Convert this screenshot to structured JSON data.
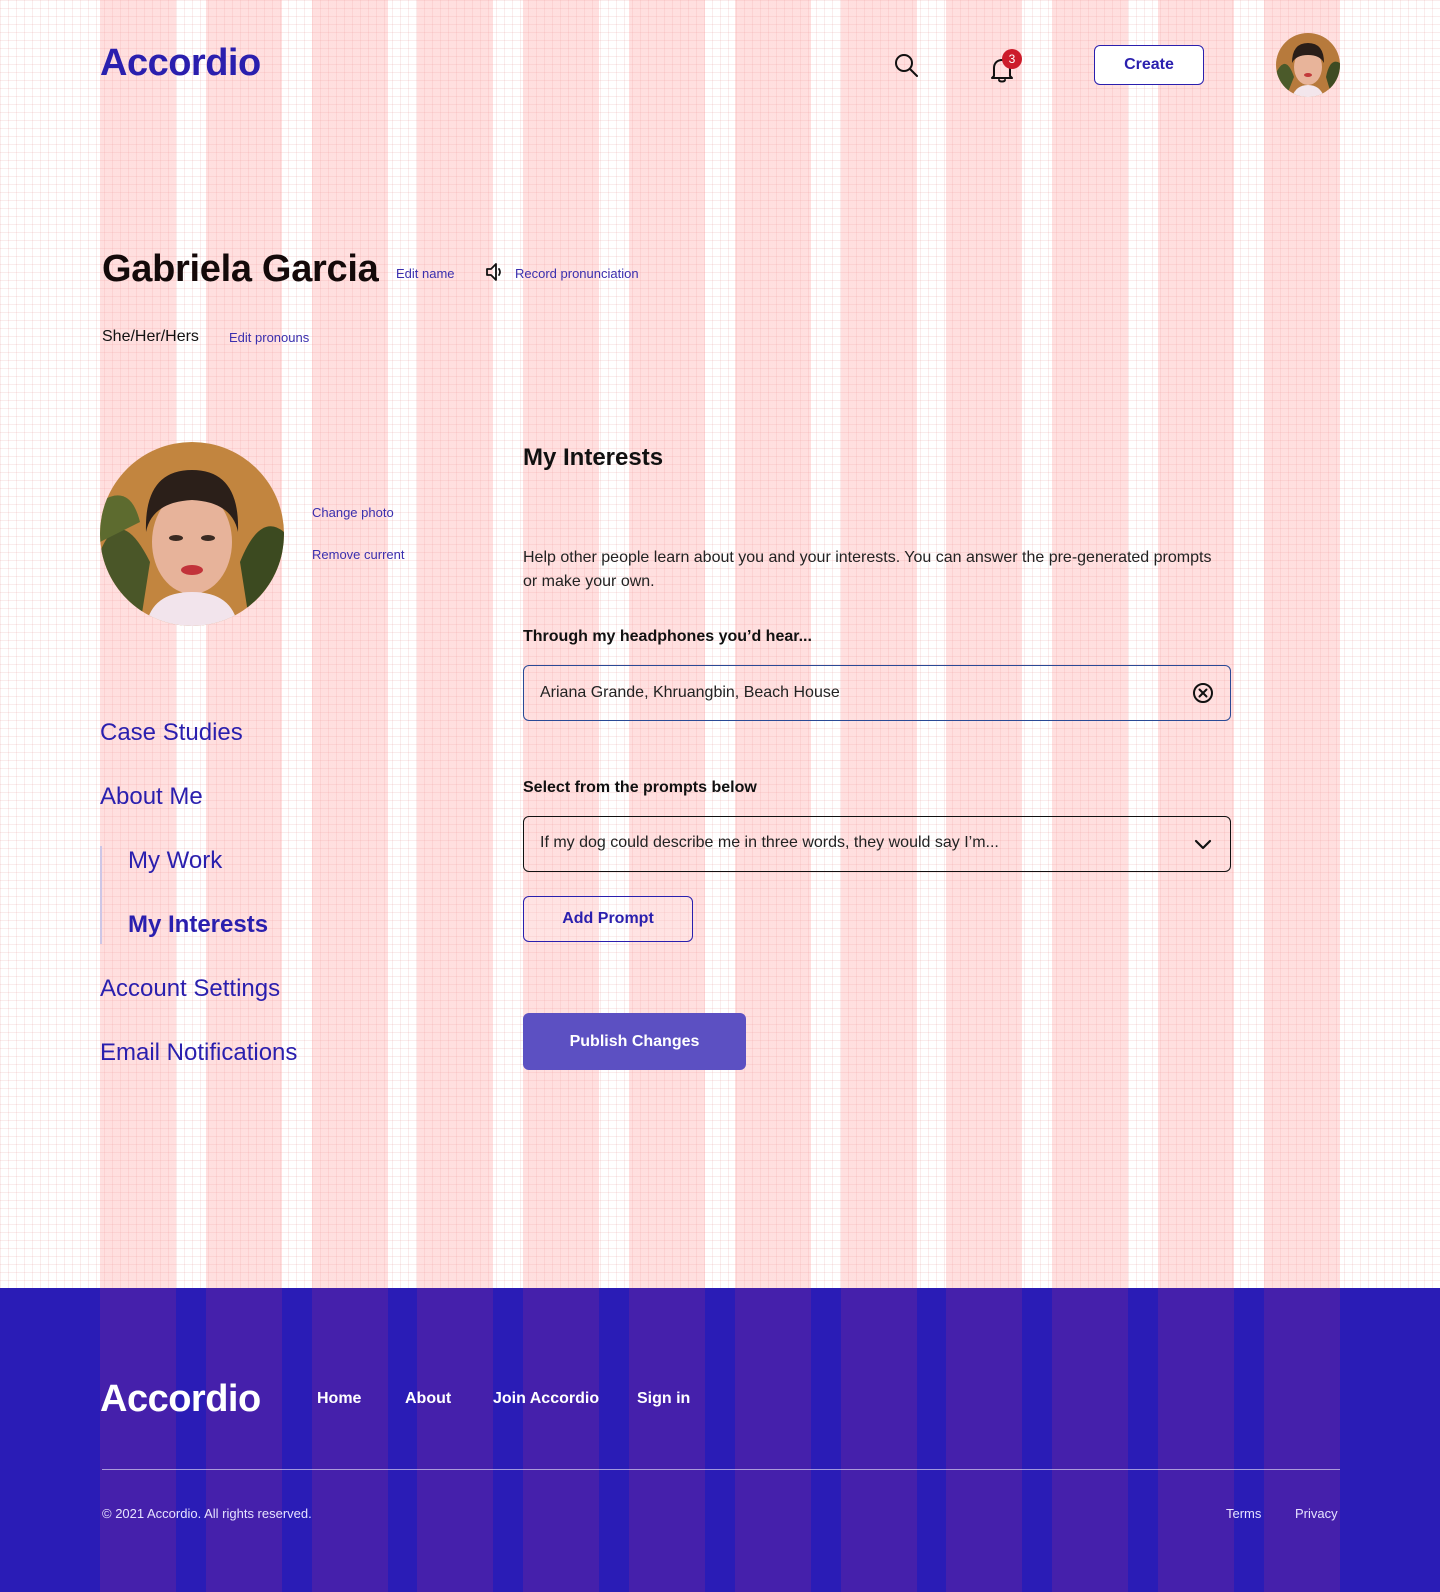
{
  "header": {
    "logo": "Accordio",
    "notification_count": "3",
    "create_label": "Create",
    "icons": [
      "search-icon",
      "bell-icon",
      "avatar"
    ]
  },
  "profile": {
    "name": "Gabriela Garcia",
    "edit_name": "Edit name",
    "record_pronunciation": "Record pronunciation",
    "pronouns": "She/Her/Hers",
    "edit_pronouns": "Edit pronouns",
    "change_photo": "Change photo",
    "remove_current": "Remove current"
  },
  "sidebar": {
    "items": [
      {
        "label": "Case Studies"
      },
      {
        "label": "About Me"
      },
      {
        "label": "My Work"
      },
      {
        "label": "My Interests",
        "active": true
      },
      {
        "label": "Account Settings"
      },
      {
        "label": "Email Notifications"
      }
    ]
  },
  "main": {
    "title": "My Interests",
    "help_text": "Help other people learn about you and your interests. You can answer the pre-generated prompts or make your own.",
    "headphones_label": "Through my headphones you’d hear...",
    "headphones_value": "Ariana Grande, Khruangbin, Beach House",
    "select_label": "Select from the prompts below",
    "select_value": "If my dog could describe me in three words, they would say I’m...",
    "add_prompt": "Add Prompt",
    "publish": "Publish Changes"
  },
  "footer": {
    "logo": "Accordio",
    "links": [
      "Home",
      "About",
      "Join Accordio",
      "Sign in"
    ],
    "copyright": "© 2021 Accordio. All rights reserved.",
    "terms": "Terms",
    "privacy": "Privacy"
  },
  "colors": {
    "brand": "#2a1fae",
    "publish_button": "#5c50c2",
    "footer_bg": "#2a1cb6",
    "badge": "#cc1b2a"
  }
}
